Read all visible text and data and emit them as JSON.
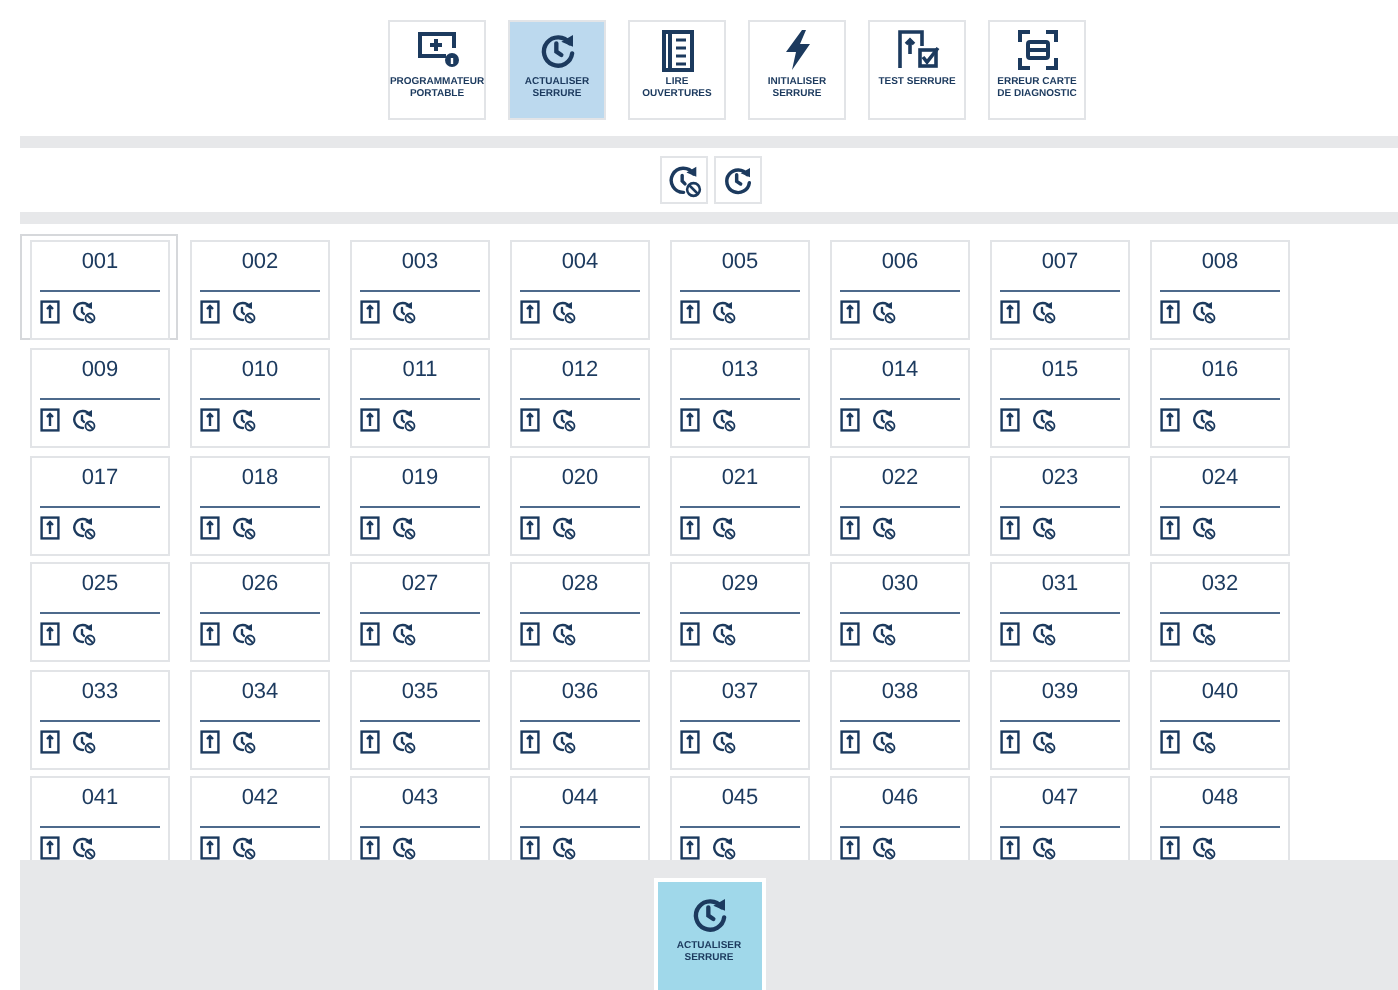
{
  "toolbar": [
    {
      "kind": "programmer",
      "label": "PROGRAMMATEUR PORTABLE",
      "selected": false
    },
    {
      "kind": "refresh",
      "label": "ACTUALISER SERRURE",
      "selected": true
    },
    {
      "kind": "list",
      "label": "LIRE OUVERTURES",
      "selected": false
    },
    {
      "kind": "bolt",
      "label": "INITIALISER SERRURE",
      "selected": false
    },
    {
      "kind": "test",
      "label": "TEST SERRURE",
      "selected": false
    },
    {
      "kind": "scan",
      "label": "ERREUR CARTE DE DIAGNOSTIC",
      "selected": false
    }
  ],
  "mini_toolbar": [
    {
      "kind": "refresh-cancel"
    },
    {
      "kind": "refresh"
    }
  ],
  "locks": [
    {
      "label": "001",
      "selected": true
    },
    {
      "label": "002",
      "selected": false
    },
    {
      "label": "003",
      "selected": false
    },
    {
      "label": "004",
      "selected": false
    },
    {
      "label": "005",
      "selected": false
    },
    {
      "label": "006",
      "selected": false
    },
    {
      "label": "007",
      "selected": false
    },
    {
      "label": "008",
      "selected": false
    },
    {
      "label": "009",
      "selected": false
    },
    {
      "label": "010",
      "selected": false
    },
    {
      "label": "011",
      "selected": false
    },
    {
      "label": "012",
      "selected": false
    },
    {
      "label": "013",
      "selected": false
    },
    {
      "label": "014",
      "selected": false
    },
    {
      "label": "015",
      "selected": false
    },
    {
      "label": "016",
      "selected": false
    },
    {
      "label": "017",
      "selected": false
    },
    {
      "label": "018",
      "selected": false
    },
    {
      "label": "019",
      "selected": false
    },
    {
      "label": "020",
      "selected": false
    },
    {
      "label": "021",
      "selected": false
    },
    {
      "label": "022",
      "selected": false
    },
    {
      "label": "023",
      "selected": false
    },
    {
      "label": "024",
      "selected": false
    },
    {
      "label": "025",
      "selected": false
    },
    {
      "label": "026",
      "selected": false
    },
    {
      "label": "027",
      "selected": false
    },
    {
      "label": "028",
      "selected": false
    },
    {
      "label": "029",
      "selected": false
    },
    {
      "label": "030",
      "selected": false
    },
    {
      "label": "031",
      "selected": false
    },
    {
      "label": "032",
      "selected": false
    },
    {
      "label": "033",
      "selected": false
    },
    {
      "label": "034",
      "selected": false
    },
    {
      "label": "035",
      "selected": false
    },
    {
      "label": "036",
      "selected": false
    },
    {
      "label": "037",
      "selected": false
    },
    {
      "label": "038",
      "selected": false
    },
    {
      "label": "039",
      "selected": false
    },
    {
      "label": "040",
      "selected": false
    },
    {
      "label": "041",
      "selected": false
    },
    {
      "label": "042",
      "selected": false
    },
    {
      "label": "043",
      "selected": false
    },
    {
      "label": "044",
      "selected": false
    },
    {
      "label": "045",
      "selected": false
    },
    {
      "label": "046",
      "selected": false
    },
    {
      "label": "047",
      "selected": false
    },
    {
      "label": "048",
      "selected": false
    }
  ],
  "action_button": {
    "kind": "refresh",
    "label": "ACTUALISER SERRURE"
  }
}
